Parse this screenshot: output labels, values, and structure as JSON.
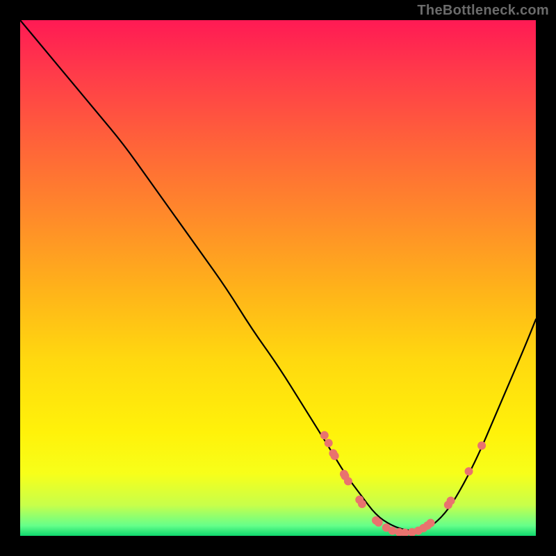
{
  "watermark": "TheBottleneck.com",
  "colors": {
    "curve": "#000000",
    "markers": "#e9736e",
    "frame": "#000000"
  },
  "chart_data": {
    "type": "line",
    "title": "",
    "xlabel": "",
    "ylabel": "",
    "xlim": [
      0,
      100
    ],
    "ylim": [
      0,
      100
    ],
    "grid": false,
    "legend": false,
    "curve": {
      "name": "bottleneck-curve",
      "x": [
        0,
        5,
        10,
        15,
        20,
        25,
        30,
        35,
        40,
        45,
        50,
        55,
        60,
        63,
        66,
        69,
        72,
        75,
        78,
        80,
        83,
        86,
        89,
        92,
        95,
        98,
        100
      ],
      "y": [
        100,
        94,
        88,
        82,
        76,
        69,
        62,
        55,
        48,
        40,
        33,
        25,
        17,
        12,
        8,
        4,
        2,
        1,
        1,
        2,
        5,
        10,
        16,
        23,
        30,
        37,
        42
      ]
    },
    "markers": {
      "name": "highlighted-points",
      "points": [
        {
          "x": 59.0,
          "y": 19.5
        },
        {
          "x": 59.8,
          "y": 18.0
        },
        {
          "x": 60.7,
          "y": 16.0
        },
        {
          "x": 61.0,
          "y": 15.5
        },
        {
          "x": 62.8,
          "y": 12.0
        },
        {
          "x": 63.0,
          "y": 11.6
        },
        {
          "x": 63.6,
          "y": 10.6
        },
        {
          "x": 65.8,
          "y": 7.0
        },
        {
          "x": 66.3,
          "y": 6.2
        },
        {
          "x": 69.0,
          "y": 3.0
        },
        {
          "x": 69.5,
          "y": 2.6
        },
        {
          "x": 71.0,
          "y": 1.6
        },
        {
          "x": 72.2,
          "y": 1.0
        },
        {
          "x": 73.5,
          "y": 0.7
        },
        {
          "x": 74.6,
          "y": 0.6
        },
        {
          "x": 76.0,
          "y": 0.7
        },
        {
          "x": 77.2,
          "y": 1.0
        },
        {
          "x": 78.2,
          "y": 1.5
        },
        {
          "x": 79.0,
          "y": 2.0
        },
        {
          "x": 79.6,
          "y": 2.5
        },
        {
          "x": 83.0,
          "y": 6.0
        },
        {
          "x": 83.5,
          "y": 6.8
        },
        {
          "x": 87.0,
          "y": 12.5
        },
        {
          "x": 89.5,
          "y": 17.5
        }
      ]
    }
  }
}
